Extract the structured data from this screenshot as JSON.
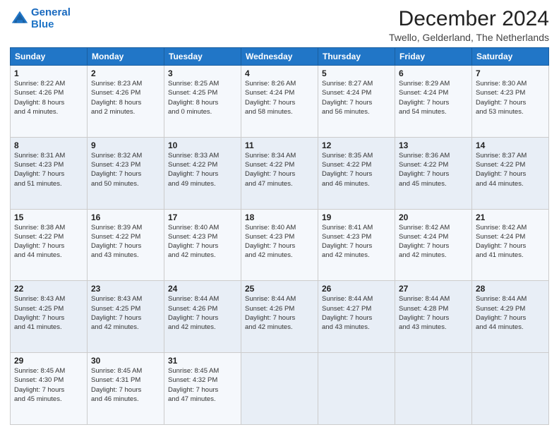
{
  "logo": {
    "line1": "General",
    "line2": "Blue"
  },
  "title": "December 2024",
  "subtitle": "Twello, Gelderland, The Netherlands",
  "days_header": [
    "Sunday",
    "Monday",
    "Tuesday",
    "Wednesday",
    "Thursday",
    "Friday",
    "Saturday"
  ],
  "weeks": [
    [
      {
        "num": "1",
        "info": "Sunrise: 8:22 AM\nSunset: 4:26 PM\nDaylight: 8 hours\nand 4 minutes."
      },
      {
        "num": "2",
        "info": "Sunrise: 8:23 AM\nSunset: 4:26 PM\nDaylight: 8 hours\nand 2 minutes."
      },
      {
        "num": "3",
        "info": "Sunrise: 8:25 AM\nSunset: 4:25 PM\nDaylight: 8 hours\nand 0 minutes."
      },
      {
        "num": "4",
        "info": "Sunrise: 8:26 AM\nSunset: 4:24 PM\nDaylight: 7 hours\nand 58 minutes."
      },
      {
        "num": "5",
        "info": "Sunrise: 8:27 AM\nSunset: 4:24 PM\nDaylight: 7 hours\nand 56 minutes."
      },
      {
        "num": "6",
        "info": "Sunrise: 8:29 AM\nSunset: 4:24 PM\nDaylight: 7 hours\nand 54 minutes."
      },
      {
        "num": "7",
        "info": "Sunrise: 8:30 AM\nSunset: 4:23 PM\nDaylight: 7 hours\nand 53 minutes."
      }
    ],
    [
      {
        "num": "8",
        "info": "Sunrise: 8:31 AM\nSunset: 4:23 PM\nDaylight: 7 hours\nand 51 minutes."
      },
      {
        "num": "9",
        "info": "Sunrise: 8:32 AM\nSunset: 4:23 PM\nDaylight: 7 hours\nand 50 minutes."
      },
      {
        "num": "10",
        "info": "Sunrise: 8:33 AM\nSunset: 4:22 PM\nDaylight: 7 hours\nand 49 minutes."
      },
      {
        "num": "11",
        "info": "Sunrise: 8:34 AM\nSunset: 4:22 PM\nDaylight: 7 hours\nand 47 minutes."
      },
      {
        "num": "12",
        "info": "Sunrise: 8:35 AM\nSunset: 4:22 PM\nDaylight: 7 hours\nand 46 minutes."
      },
      {
        "num": "13",
        "info": "Sunrise: 8:36 AM\nSunset: 4:22 PM\nDaylight: 7 hours\nand 45 minutes."
      },
      {
        "num": "14",
        "info": "Sunrise: 8:37 AM\nSunset: 4:22 PM\nDaylight: 7 hours\nand 44 minutes."
      }
    ],
    [
      {
        "num": "15",
        "info": "Sunrise: 8:38 AM\nSunset: 4:22 PM\nDaylight: 7 hours\nand 44 minutes."
      },
      {
        "num": "16",
        "info": "Sunrise: 8:39 AM\nSunset: 4:22 PM\nDaylight: 7 hours\nand 43 minutes."
      },
      {
        "num": "17",
        "info": "Sunrise: 8:40 AM\nSunset: 4:23 PM\nDaylight: 7 hours\nand 42 minutes."
      },
      {
        "num": "18",
        "info": "Sunrise: 8:40 AM\nSunset: 4:23 PM\nDaylight: 7 hours\nand 42 minutes."
      },
      {
        "num": "19",
        "info": "Sunrise: 8:41 AM\nSunset: 4:23 PM\nDaylight: 7 hours\nand 42 minutes."
      },
      {
        "num": "20",
        "info": "Sunrise: 8:42 AM\nSunset: 4:24 PM\nDaylight: 7 hours\nand 42 minutes."
      },
      {
        "num": "21",
        "info": "Sunrise: 8:42 AM\nSunset: 4:24 PM\nDaylight: 7 hours\nand 41 minutes."
      }
    ],
    [
      {
        "num": "22",
        "info": "Sunrise: 8:43 AM\nSunset: 4:25 PM\nDaylight: 7 hours\nand 41 minutes."
      },
      {
        "num": "23",
        "info": "Sunrise: 8:43 AM\nSunset: 4:25 PM\nDaylight: 7 hours\nand 42 minutes."
      },
      {
        "num": "24",
        "info": "Sunrise: 8:44 AM\nSunset: 4:26 PM\nDaylight: 7 hours\nand 42 minutes."
      },
      {
        "num": "25",
        "info": "Sunrise: 8:44 AM\nSunset: 4:26 PM\nDaylight: 7 hours\nand 42 minutes."
      },
      {
        "num": "26",
        "info": "Sunrise: 8:44 AM\nSunset: 4:27 PM\nDaylight: 7 hours\nand 43 minutes."
      },
      {
        "num": "27",
        "info": "Sunrise: 8:44 AM\nSunset: 4:28 PM\nDaylight: 7 hours\nand 43 minutes."
      },
      {
        "num": "28",
        "info": "Sunrise: 8:44 AM\nSunset: 4:29 PM\nDaylight: 7 hours\nand 44 minutes."
      }
    ],
    [
      {
        "num": "29",
        "info": "Sunrise: 8:45 AM\nSunset: 4:30 PM\nDaylight: 7 hours\nand 45 minutes."
      },
      {
        "num": "30",
        "info": "Sunrise: 8:45 AM\nSunset: 4:31 PM\nDaylight: 7 hours\nand 46 minutes."
      },
      {
        "num": "31",
        "info": "Sunrise: 8:45 AM\nSunset: 4:32 PM\nDaylight: 7 hours\nand 47 minutes."
      },
      null,
      null,
      null,
      null
    ]
  ]
}
